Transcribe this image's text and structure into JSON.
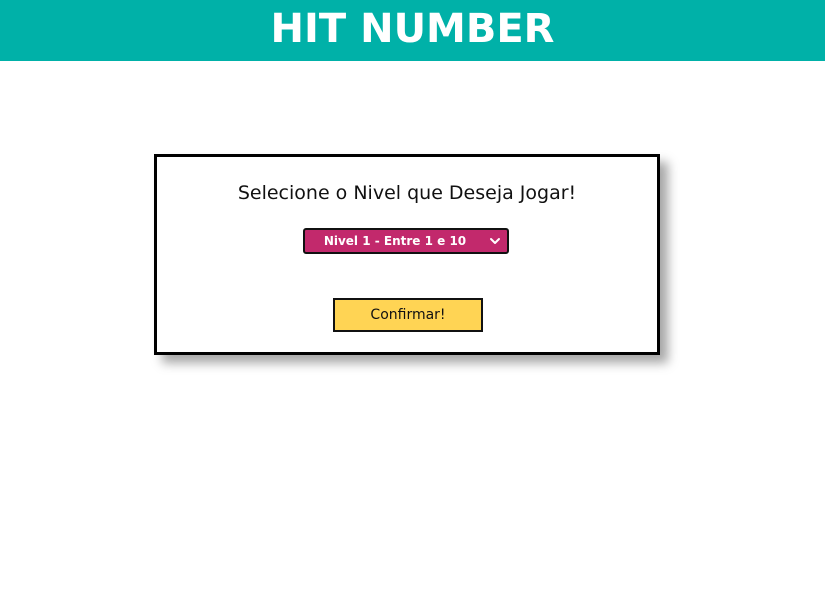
{
  "header": {
    "title": "HIT NUMBER",
    "background_color": "#00b1a8"
  },
  "level_card": {
    "title": "Selecione o Nivel que Deseja Jogar!",
    "level_select": {
      "selected_label": "Nivel 1 - Entre 1 e 10",
      "background_color": "#c2296c",
      "icon": "chevron-down-icon"
    },
    "confirm_button": {
      "label": "Confirmar!",
      "background_color": "#ffd454"
    }
  }
}
